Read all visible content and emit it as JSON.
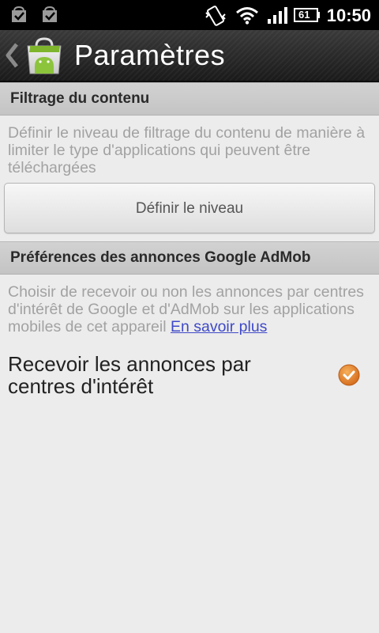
{
  "status_bar": {
    "time": "10:50",
    "battery_level": "61",
    "notification_icons": [
      "market-download-icon",
      "market-download-icon"
    ],
    "status_icons": [
      "vibrate-icon",
      "wifi-icon",
      "signal-icon",
      "battery-icon"
    ]
  },
  "action_bar": {
    "title": "Paramètres",
    "back_icon": "back-chevron-icon",
    "app_icon": "android-market-icon"
  },
  "content_filter": {
    "header": "Filtrage du contenu",
    "description": "Définir le niveau de filtrage du contenu de manière à limiter le type d'applications qui peuvent être téléchargées",
    "button_label": "Définir le niveau"
  },
  "admob": {
    "header": "Préférences des annonces Google AdMob",
    "description": "Choisir de recevoir ou non les annonces par centres d'intérêt de Google et d'AdMob sur les applications mobiles de cet appareil ",
    "link_text": "En savoir plus",
    "checkbox_label": "Recevoir les annonces par centres d'intérêt",
    "checkbox_checked": true
  },
  "colors": {
    "accent": "#e8832a",
    "link": "#3f49c7",
    "header_bg": "#c8c8c8",
    "page_bg": "#ececec"
  }
}
